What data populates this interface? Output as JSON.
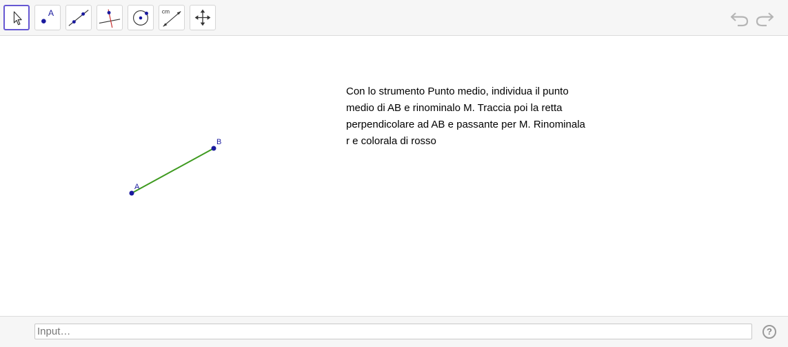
{
  "toolbar": {
    "tools": [
      {
        "name": "move-tool",
        "icon": "cursor-arrow-icon",
        "selected": true
      },
      {
        "name": "point-tool",
        "icon": "point-icon",
        "label": "A"
      },
      {
        "name": "line-tool",
        "icon": "line-through-two-points-icon"
      },
      {
        "name": "perpendicular-line-tool",
        "icon": "perpendicular-line-icon"
      },
      {
        "name": "circle-tool",
        "icon": "circle-center-point-icon"
      },
      {
        "name": "distance-tool",
        "icon": "distance-length-icon",
        "label": "cm"
      },
      {
        "name": "move-graphics-view-tool",
        "icon": "move-arrows-icon"
      }
    ],
    "undo_icon": "undo-icon",
    "redo_icon": "redo-icon"
  },
  "graphics": {
    "points": [
      {
        "label": "A"
      },
      {
        "label": "B"
      }
    ],
    "segment_color": "#3e9a1f",
    "point_color": "#1a1a9e"
  },
  "instruction": {
    "lines": [
      "Con lo strumento Punto medio, individua il punto",
      "medio di AB e rinominalo M. Traccia poi la retta",
      "perpendicolare ad AB e passante per M. Rinominala",
      "r e colorala di rosso"
    ]
  },
  "inputbar": {
    "placeholder": "Input…",
    "help_label": "?"
  },
  "colors": {
    "accent": "#6557d2",
    "toolbar_bg": "#f6f6f6"
  }
}
